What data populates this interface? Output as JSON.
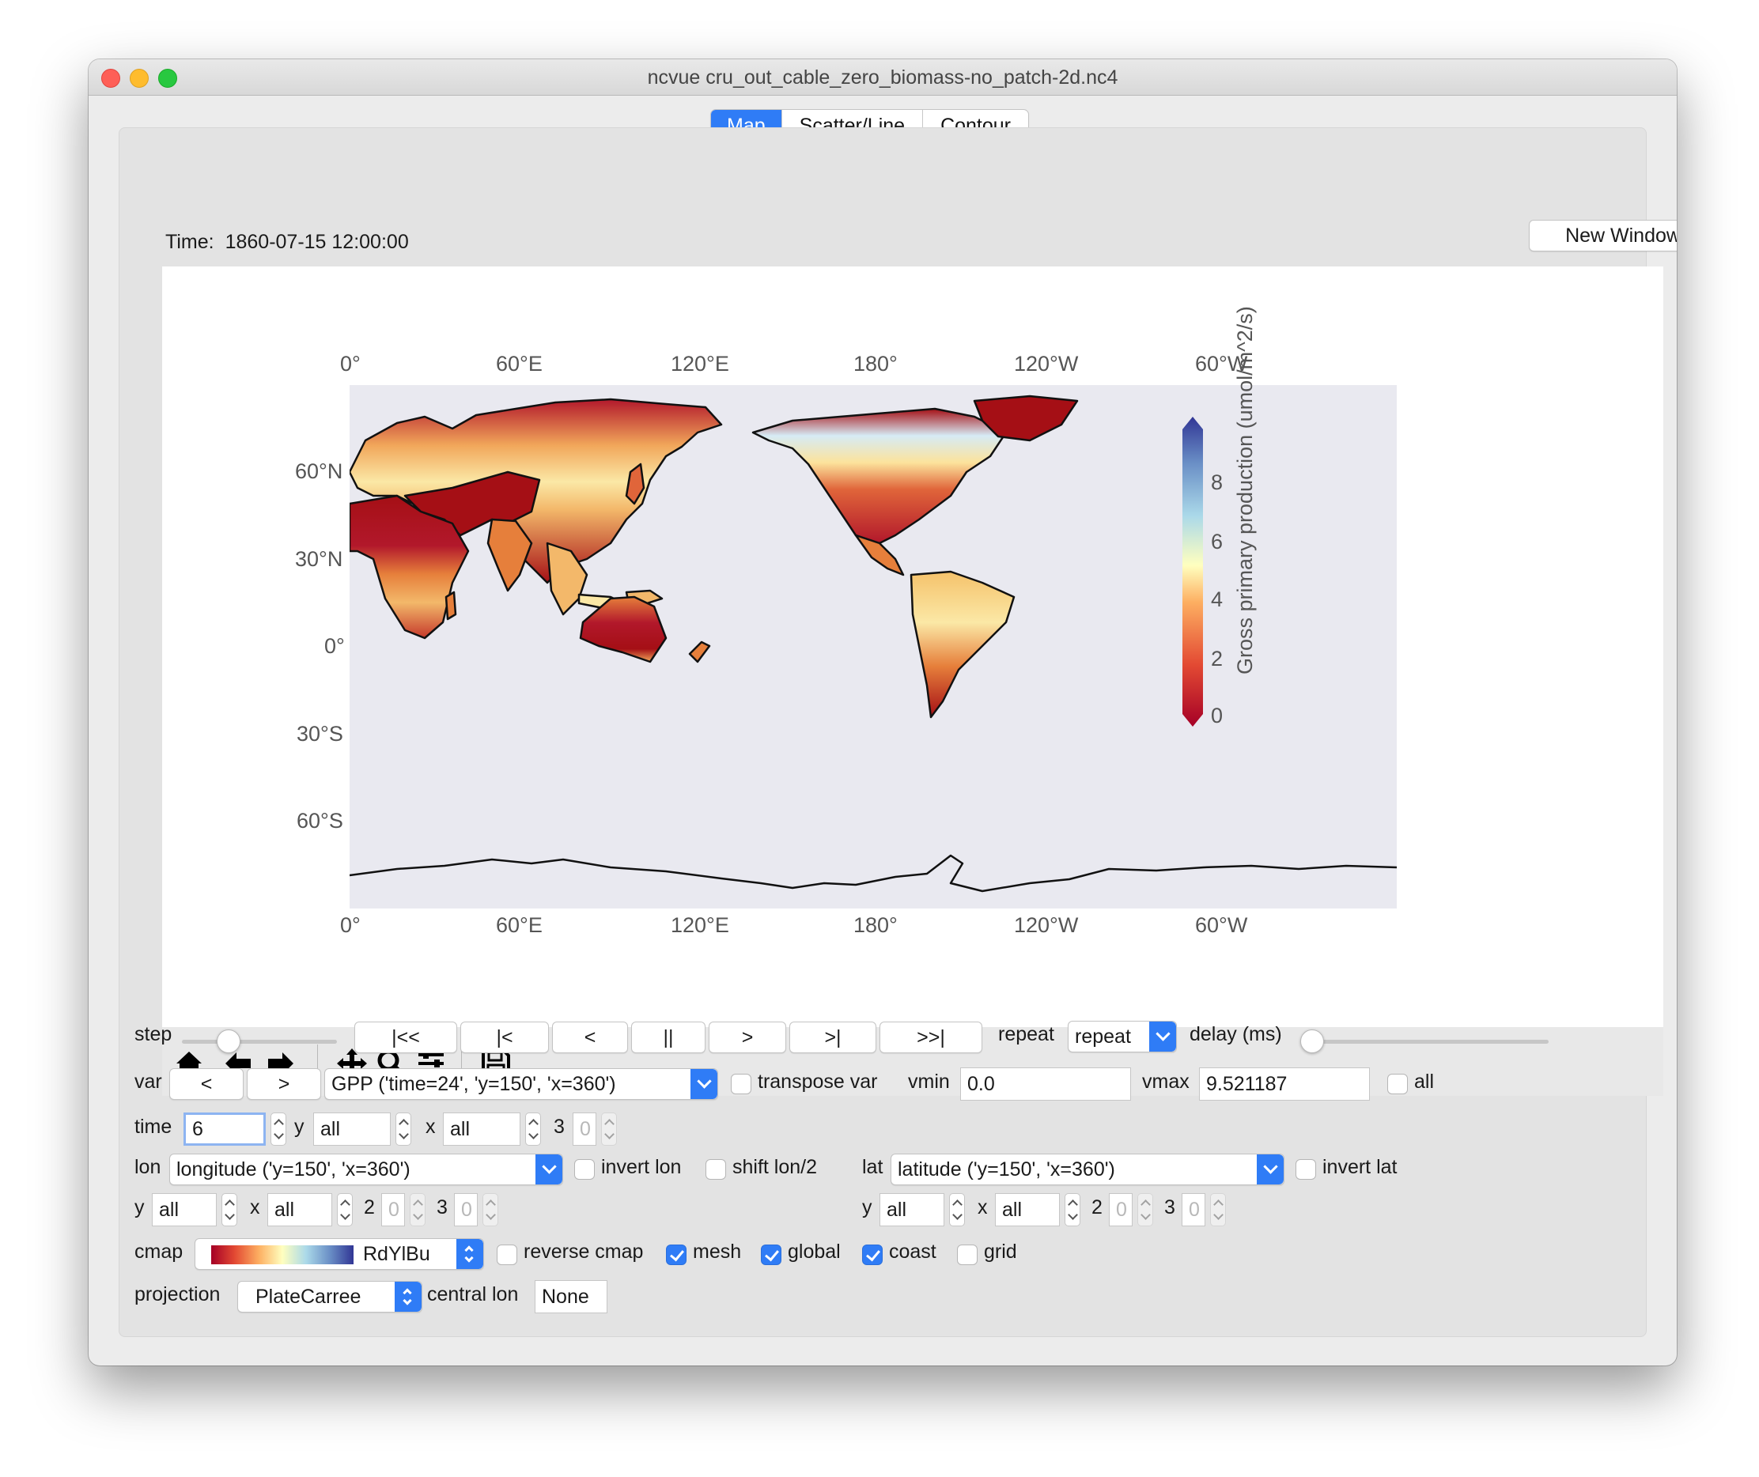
{
  "window": {
    "title": "ncvue cru_out_cable_zero_biomass-no_patch-2d.nc4"
  },
  "tabs": [
    "Map",
    "Scatter/Line",
    "Contour"
  ],
  "header": {
    "time_label": "Time:",
    "time_value": "1860-07-15 12:00:00",
    "new_window": "New Window"
  },
  "map": {
    "top_ticks": [
      "0°",
      "60°E",
      "120°E",
      "180°",
      "120°W",
      "60°W"
    ],
    "bottom_ticks": [
      "0°",
      "60°E",
      "120°E",
      "180°",
      "120°W",
      "60°W"
    ],
    "lat_ticks": [
      "60°N",
      "30°N",
      "0°",
      "30°S",
      "60°S"
    ],
    "colorbar_ticks": [
      "0",
      "2",
      "4",
      "6",
      "8"
    ],
    "colorbar_label": "Gross primary production (umol/m^2/s)"
  },
  "toolbar": {
    "icons": [
      "home-icon",
      "back-arrow-icon",
      "forward-arrow-icon",
      "pan-icon",
      "zoom-icon",
      "configure-icon",
      "save-icon"
    ]
  },
  "controls": {
    "step_label": "step",
    "nav_buttons": [
      "|<<",
      "|<",
      "<",
      "||",
      ">",
      ">|",
      ">>|"
    ],
    "repeat_label": "repeat",
    "repeat_value": "repeat",
    "delay_label": "delay (ms)",
    "var_label": "var",
    "var_prev": "<",
    "var_next": ">",
    "var_value": "GPP ('time=24', 'y=150', 'x=360')",
    "transpose_label": "transpose var",
    "vmin_label": "vmin",
    "vmin_value": "0.0",
    "vmax_label": "vmax",
    "vmax_value": "9.521187",
    "all_label": "all",
    "time_label": "time",
    "time_value": "6",
    "y_label": "y",
    "y_value": "all",
    "x_label": "x",
    "x_value": "all",
    "dim3_label": "3",
    "dim3_value": "0",
    "lon_label": "lon",
    "lon_value": "longitude ('y=150', 'x=360')",
    "invert_lon": "invert lon",
    "shift_lon": "shift lon/2",
    "lat_label": "lat",
    "lat_value": "latitude ('y=150', 'x=360')",
    "invert_lat": "invert lat",
    "lon_y_label": "y",
    "lon_y_value": "all",
    "lon_x_label": "x",
    "lon_x_value": "all",
    "lon_d2_label": "2",
    "lon_d2_value": "0",
    "lon_d3_label": "3",
    "lon_d3_value": "0",
    "lat_y_label": "y",
    "lat_y_value": "all",
    "lat_x_label": "x",
    "lat_x_value": "all",
    "lat_d2_label": "2",
    "lat_d2_value": "0",
    "lat_d3_label": "3",
    "lat_d3_value": "0",
    "cmap_label": "cmap",
    "cmap_value": "RdYlBu",
    "reverse_cmap": "reverse cmap",
    "mesh": "mesh",
    "global": "global",
    "coast": "coast",
    "grid": "grid",
    "projection_label": "projection",
    "projection_value": "PlateCarree",
    "central_lon_label": "central lon",
    "central_lon_value": "None"
  }
}
